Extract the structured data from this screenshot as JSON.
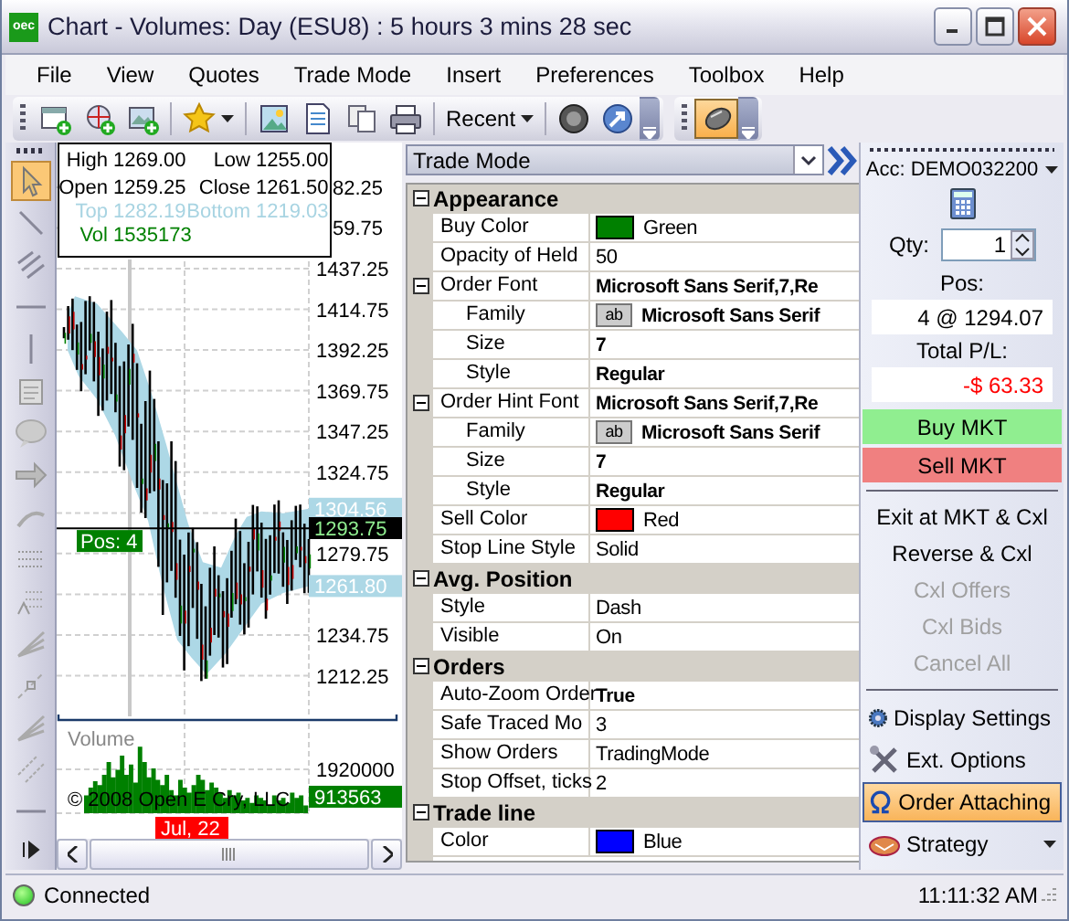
{
  "window": {
    "logo": "oec",
    "title": "Chart - Volumes: Day (ESU8) : 5 hours 3 mins 28 sec"
  },
  "menu": [
    "File",
    "View",
    "Quotes",
    "Trade Mode",
    "Insert",
    "Preferences",
    "Toolbox",
    "Help"
  ],
  "toolbar": [
    {
      "kind": "new-window",
      "pressed": false
    },
    {
      "kind": "globe-plus",
      "pressed": false
    },
    {
      "kind": "image-plus",
      "pressed": false
    },
    {
      "kind": "star",
      "pressed": false
    },
    {
      "kind": "picture",
      "pressed": false
    },
    {
      "kind": "document",
      "pressed": false
    },
    {
      "kind": "copy",
      "pressed": false
    },
    {
      "kind": "print",
      "pressed": false
    },
    {
      "kind": "recent",
      "label": "Recent",
      "pressed": false
    },
    {
      "kind": "record",
      "pressed": false
    },
    {
      "kind": "arrow-circle",
      "pressed": false
    },
    {
      "kind": "overflow",
      "pressed": false
    },
    {
      "kind": "mouse",
      "pressed": true
    },
    {
      "kind": "overflow",
      "pressed": false
    }
  ],
  "tools": [
    {
      "kind": "pointer",
      "selected": true
    },
    {
      "kind": "line",
      "selected": false
    },
    {
      "kind": "parallel",
      "selected": false
    },
    {
      "kind": "hline",
      "selected": false
    },
    {
      "kind": "vline",
      "selected": false
    },
    {
      "kind": "note",
      "selected": false
    },
    {
      "kind": "callout",
      "selected": false
    },
    {
      "kind": "arrow",
      "selected": false
    },
    {
      "kind": "arc",
      "selected": false
    },
    {
      "kind": "grid",
      "selected": false
    },
    {
      "kind": "fibo",
      "selected": false
    },
    {
      "kind": "fan",
      "selected": false
    },
    {
      "kind": "ruler",
      "selected": false
    },
    {
      "kind": "fan",
      "selected": false
    },
    {
      "kind": "dline",
      "selected": false
    },
    {
      "kind": "hline",
      "selected": false
    }
  ],
  "chart": {
    "info": [
      {
        "label": "High",
        "value": "1269.00",
        "kind": "price"
      },
      {
        "label": "Low",
        "value": "1255.00",
        "kind": "price"
      },
      {
        "label": "Open",
        "value": "1259.25",
        "kind": "price"
      },
      {
        "label": "Close",
        "value": "1261.50",
        "kind": "price"
      },
      {
        "label": "Top",
        "value": "1282.19",
        "kind": "band"
      },
      {
        "label": "Bottom",
        "value": "1219.03",
        "kind": "band"
      },
      {
        "label": "Vol",
        "value": "1535173",
        "kind": "volume"
      }
    ],
    "price_ticks": [
      "82.25",
      "59.75",
      "1437.25",
      "1414.75",
      "1392.25",
      "1369.75",
      "1347.25",
      "1324.75",
      "1279.75",
      "1234.75",
      "1212.25"
    ],
    "markers": [
      {
        "label": "1304.56",
        "kind": "band"
      },
      {
        "label": "1293.75",
        "kind": "last"
      },
      {
        "label": "1261.80",
        "kind": "band"
      }
    ],
    "position_tag": "Pos: 4",
    "volume": {
      "title": "Volume",
      "tick": "1920000",
      "marker": "913563"
    },
    "copyright": "© 2008 Open E Cry, LLC",
    "date_tag": "Jul, 22"
  },
  "properties": {
    "selector": "Trade Mode",
    "categories": [
      {
        "name": "Appearance",
        "expanded": true,
        "rows": [
          {
            "name": "Buy Color",
            "value": "Green",
            "kind": "color",
            "color": "#008000",
            "bold": false
          },
          {
            "name": "Opacity of Held",
            "value": "50",
            "kind": "text",
            "bold": false
          },
          {
            "name": "Order Font",
            "value": "Microsoft Sans Serif,7,Re",
            "kind": "text",
            "bold": true,
            "expanded": true,
            "children": [
              {
                "name": "Family",
                "value": "Microsoft Sans Serif",
                "kind": "font",
                "preview": "ab",
                "bold": true
              },
              {
                "name": "Size",
                "value": "7",
                "kind": "text",
                "bold": true
              },
              {
                "name": "Style",
                "value": "Regular",
                "kind": "text",
                "bold": true
              }
            ]
          },
          {
            "name": "Order Hint Font",
            "value": "Microsoft Sans Serif,7,Re",
            "kind": "text",
            "bold": true,
            "expanded": true,
            "children": [
              {
                "name": "Family",
                "value": "Microsoft Sans Serif",
                "kind": "font",
                "preview": "ab",
                "bold": true
              },
              {
                "name": "Size",
                "value": "7",
                "kind": "text",
                "bold": true
              },
              {
                "name": "Style",
                "value": "Regular",
                "kind": "text",
                "bold": true
              }
            ]
          },
          {
            "name": "Sell Color",
            "value": "Red",
            "kind": "color",
            "color": "#ff0000",
            "bold": false
          },
          {
            "name": "Stop Line Style",
            "value": "Solid",
            "kind": "text",
            "bold": false
          }
        ]
      },
      {
        "name": "Avg. Position",
        "expanded": true,
        "rows": [
          {
            "name": "Style",
            "value": "Dash",
            "kind": "text",
            "bold": false
          },
          {
            "name": "Visible",
            "value": "On",
            "kind": "text",
            "bold": false
          }
        ]
      },
      {
        "name": "Orders",
        "expanded": true,
        "rows": [
          {
            "name": "Auto-Zoom Order",
            "value": "True",
            "kind": "text",
            "bold": true
          },
          {
            "name": "Safe Traced Mo",
            "value": "3",
            "kind": "text",
            "bold": false
          },
          {
            "name": "Show Orders",
            "value": "TradingMode",
            "kind": "text",
            "bold": false
          },
          {
            "name": "Stop Offset, ticks",
            "value": "2",
            "kind": "text",
            "bold": false
          }
        ]
      },
      {
        "name": "Trade line",
        "expanded": true,
        "rows": [
          {
            "name": "Color",
            "value": "Blue",
            "kind": "color",
            "color": "#0000ff",
            "bold": false
          }
        ]
      }
    ]
  },
  "trade": {
    "account": "Acc: DEMO032200",
    "qty_label": "Qty:",
    "qty": "1",
    "pos_label": "Pos:",
    "pos": "4 @ 1294.07",
    "pl_label": "Total P/L:",
    "pl": "-$ 63.33",
    "buy": "Buy MKT",
    "sell": "Sell MKT",
    "actions": [
      {
        "label": "Exit at MKT & Cxl",
        "disabled": false
      },
      {
        "label": "Reverse & Cxl",
        "disabled": false
      },
      {
        "label": "Cxl Offers",
        "disabled": true
      },
      {
        "label": "Cxl Bids",
        "disabled": true
      },
      {
        "label": "Cancel All",
        "disabled": true
      }
    ],
    "tools": [
      {
        "label": "Display Settings",
        "kind": "gear",
        "selected": false,
        "menu": false
      },
      {
        "label": "Ext. Options",
        "kind": "tools",
        "selected": false,
        "menu": false
      },
      {
        "label": "Order Attaching",
        "kind": "omega",
        "selected": true,
        "menu": false
      },
      {
        "label": "Strategy",
        "kind": "hand",
        "selected": false,
        "menu": true
      }
    ]
  },
  "status": {
    "connected": true,
    "text": "Connected",
    "time": "11:11:32 AM"
  }
}
